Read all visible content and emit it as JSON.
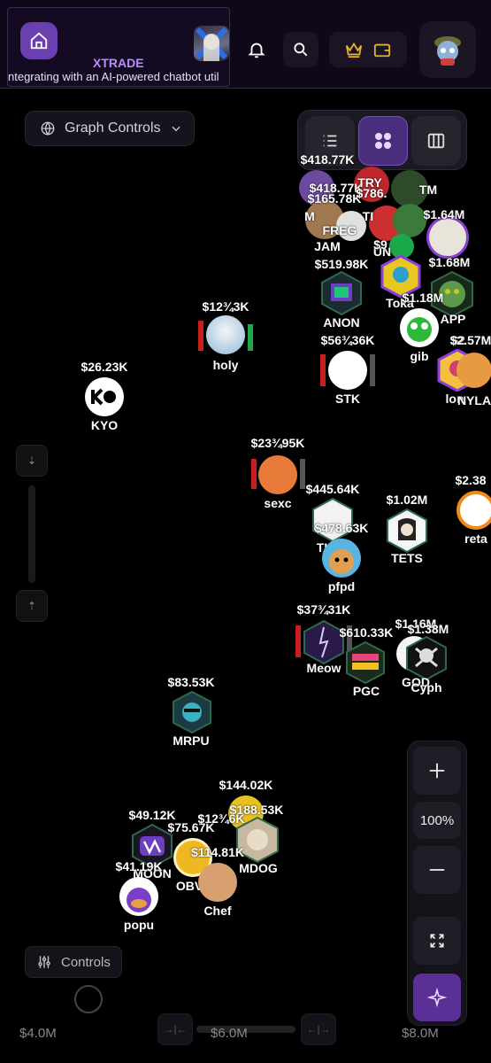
{
  "header": {
    "ticker": {
      "name": "XTRADE",
      "text": "ntegrating with an AI-powered chatbot util"
    }
  },
  "graph_controls_label": "Graph Controls",
  "zoom": {
    "percent": "100%"
  },
  "controls_label": "Controls",
  "axis": {
    "left": "$4.0M",
    "mid": "$6.0M",
    "right": "$8.0M"
  },
  "tokens": [
    {
      "name": "M",
      "value": "$418.77K"
    },
    {
      "name": "TI",
      "value": "$165.78K"
    },
    {
      "name": "TRY",
      "value": "$786."
    },
    {
      "name": "FREG",
      "value": ""
    },
    {
      "name": "JAM",
      "value": ""
    },
    {
      "name": "UN",
      "value": "$9"
    },
    {
      "name": "TM",
      "value": ""
    },
    {
      "name": "$1.64M",
      "value": ""
    },
    {
      "name": "$1.68M",
      "value": ""
    },
    {
      "name": "ANON",
      "value": "$519.98K"
    },
    {
      "name": "Toka",
      "value": ""
    },
    {
      "name": "$1.18M",
      "value": ""
    },
    {
      "name": "APP",
      "value": ""
    },
    {
      "name": "holy",
      "value": "$12¾3K"
    },
    {
      "name": "STK",
      "value": "$56¾36K"
    },
    {
      "name": "gib",
      "value": "$2"
    },
    {
      "name": "lon",
      "value": "$2.57M"
    },
    {
      "name": "NYLA",
      "value": ""
    },
    {
      "name": "KYO",
      "value": "$26.23K"
    },
    {
      "name": "sexc",
      "value": "$23¾95K"
    },
    {
      "name": "TI",
      "value": "$445.64K"
    },
    {
      "name": "pfpd",
      "value": "$478.63K"
    },
    {
      "name": "TETS",
      "value": "$1.02M"
    },
    {
      "name": "reta",
      "value": "$2.38"
    },
    {
      "name": "Meow",
      "value": "$37¾31K"
    },
    {
      "name": "PGC",
      "value": "$610.33K"
    },
    {
      "name": "GOD",
      "value": "$1.16M"
    },
    {
      "name": "Cyph",
      "value": "$1.38M"
    },
    {
      "name": "MRPU",
      "value": "$83.53K"
    },
    {
      "name": "MDOG",
      "value": "$144.02K"
    },
    {
      "name": "",
      "value": "$188.53K"
    },
    {
      "name": "MOON",
      "value": "$49.12K"
    },
    {
      "name": "OBV",
      "value": "$75.67K"
    },
    {
      "name": "",
      "value": "$12¾6K"
    },
    {
      "name": "Chef",
      "value": "$114.81K"
    },
    {
      "name": "popu",
      "value": "$41.19K"
    }
  ],
  "colors": {
    "accent": "#7b44d6",
    "bg": "#000000"
  }
}
